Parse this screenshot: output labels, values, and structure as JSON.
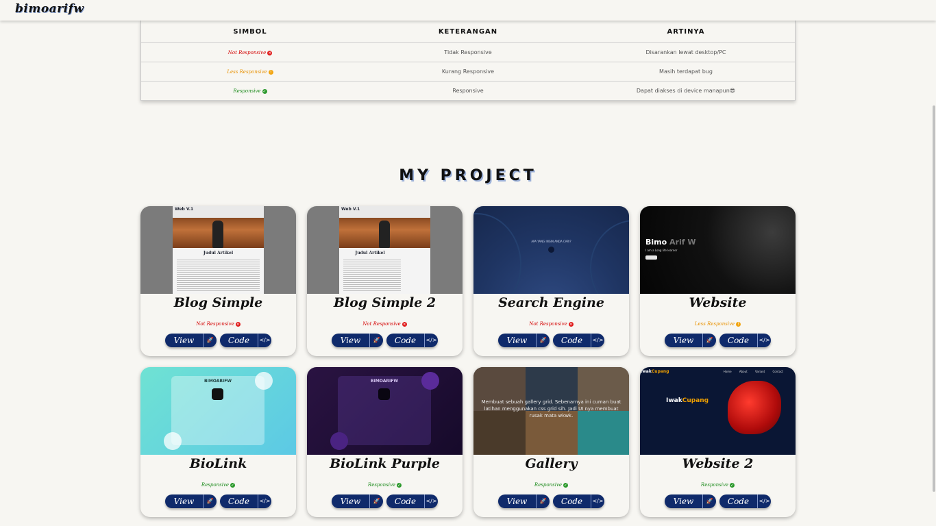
{
  "header": {
    "logo": "bimoarifw"
  },
  "legend": {
    "columns": [
      "SIMBOL",
      "KETERANGAN",
      "ARTINYA"
    ],
    "rows": [
      {
        "symbol": "Not Responsive",
        "status": "red",
        "desc": "Tidak Responsive",
        "meaning": "Disarankan lewat desktop/PC"
      },
      {
        "symbol": "Less Responsive",
        "status": "orange",
        "desc": "Kurang Responsive",
        "meaning": "Masih terdapat bug"
      },
      {
        "symbol": "Responsive",
        "status": "green",
        "desc": "Responsive",
        "meaning": "Dapat diakses di device manapun😎"
      }
    ]
  },
  "section": {
    "title": "MY PROJECT"
  },
  "buttons": {
    "view": "View",
    "code": "Code"
  },
  "thumbs": {
    "blog_header": "Web V.1",
    "blog_article": "Judul Artikel",
    "search_text": "APA YANG INGIN ANDA CARI?",
    "website_name": "Bimo",
    "website_name2": "Arif W",
    "website_sub": "I am a Long life learner",
    "biolink_name": "BIMOARIFW",
    "gallery_caption": "Membuat sebuah gallery grid. Sebenarnya ini cuman buat latihan menggunakan css grid sih. Jadi UI nya membuat rusak mata wkwk.",
    "ikan_logo1": "Iwak",
    "ikan_logo2": "Cupang",
    "ikan_nav": "Home About Variant Contact",
    "ikan_title1": "Iwak",
    "ikan_title2": "Cupang"
  },
  "projects": [
    {
      "title": "Blog Simple",
      "status": "Not Responsive",
      "color": "red"
    },
    {
      "title": "Blog Simple 2",
      "status": "Not Responsive",
      "color": "red"
    },
    {
      "title": "Search Engine",
      "status": "Not Responsive",
      "color": "red"
    },
    {
      "title": "Website",
      "status": "Less Responsive",
      "color": "orange"
    },
    {
      "title": "BioLink",
      "status": "Responsive",
      "color": "green"
    },
    {
      "title": "BioLink Purple",
      "status": "Responsive",
      "color": "green"
    },
    {
      "title": "Gallery",
      "status": "Responsive",
      "color": "green"
    },
    {
      "title": "Website 2",
      "status": "Responsive",
      "color": "green"
    }
  ],
  "colors": {
    "primary": "#0f2a6b",
    "red": "#e01c1c",
    "orange": "#f2a40f",
    "green": "#2e9a2e"
  }
}
